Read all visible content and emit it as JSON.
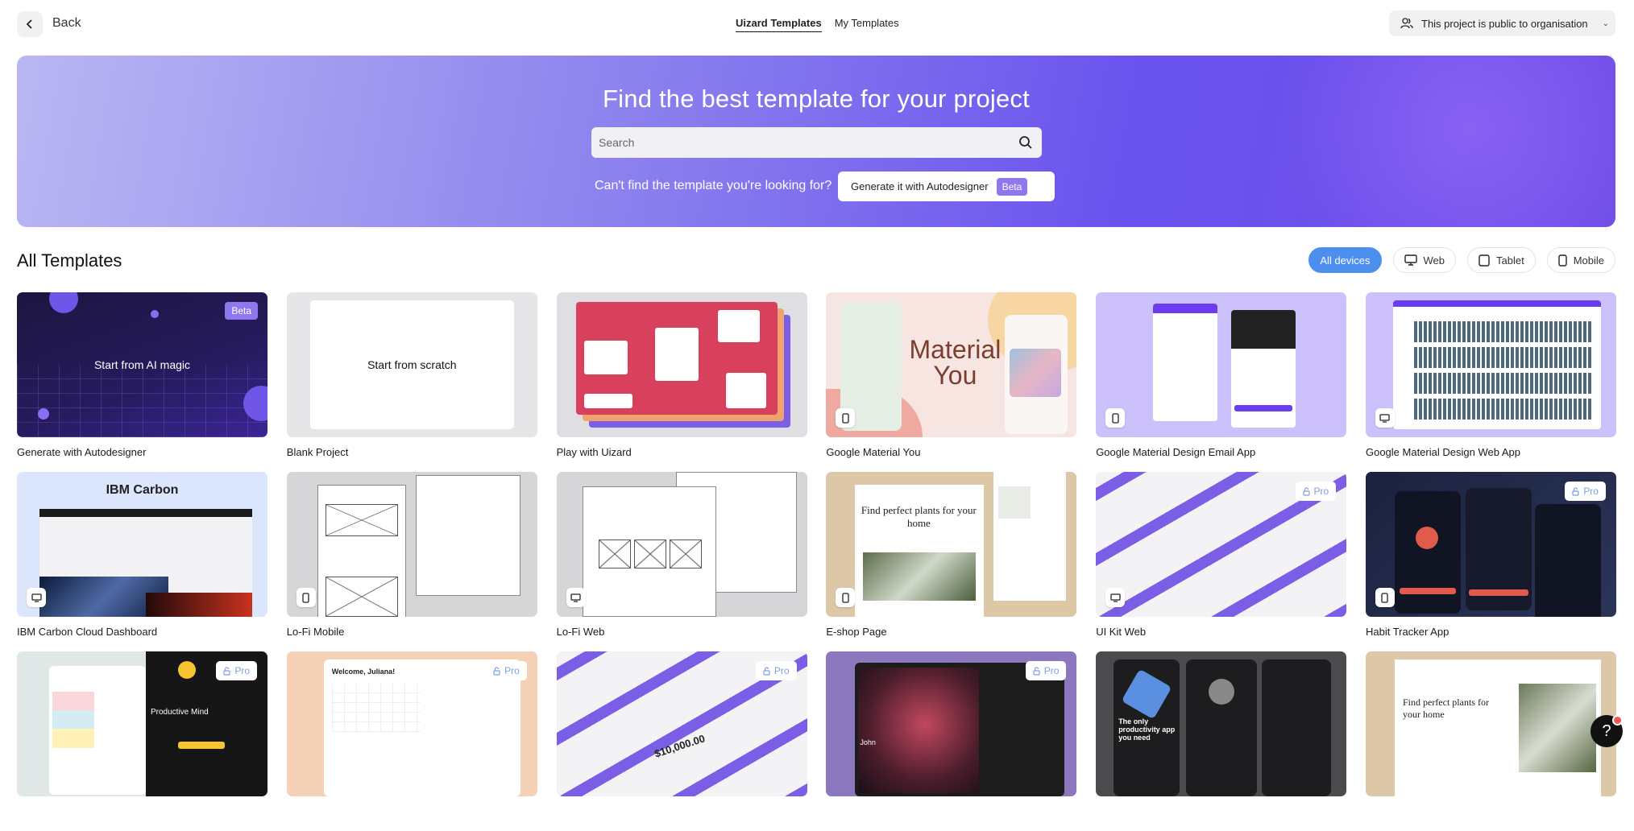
{
  "topbar": {
    "back_label": "Back",
    "tabs": [
      {
        "label": "Uizard Templates",
        "active": true
      },
      {
        "label": "My Templates",
        "active": false
      }
    ],
    "visibility_label": "This project is public to organisation"
  },
  "hero": {
    "title": "Find the best template for your project",
    "search_placeholder": "Search",
    "cant_find": "Can't find the template you're looking for?",
    "generate_label": "Generate it with Autodesigner",
    "generate_badge": "Beta"
  },
  "section": {
    "title": "All Templates",
    "filters": [
      {
        "label": "All devices",
        "active": true,
        "icon": ""
      },
      {
        "label": "Web",
        "active": false,
        "icon": "monitor-icon"
      },
      {
        "label": "Tablet",
        "active": false,
        "icon": "tablet-icon"
      },
      {
        "label": "Mobile",
        "active": false,
        "icon": "mobile-icon"
      }
    ]
  },
  "templates": [
    {
      "label": "Generate with Autodesigner",
      "thumb_text": "Start from AI magic",
      "badge": "Beta",
      "device": ""
    },
    {
      "label": "Blank Project",
      "thumb_text": "Start from scratch",
      "badge": "",
      "device": ""
    },
    {
      "label": "Play with Uizard",
      "thumb_text": "",
      "badge": "",
      "device": ""
    },
    {
      "label": "Google Material You",
      "thumb_text": "Material You",
      "badge": "",
      "device": "mobile-icon"
    },
    {
      "label": "Google Material Design Email App",
      "thumb_text": "",
      "badge": "",
      "device": "mobile-icon"
    },
    {
      "label": "Google Material Design Web App",
      "thumb_text": "",
      "badge": "",
      "device": "monitor-icon"
    },
    {
      "label": "IBM Carbon Cloud Dashboard",
      "thumb_text": "IBM Carbon",
      "badge": "",
      "device": "monitor-icon"
    },
    {
      "label": "Lo-Fi Mobile",
      "thumb_text": "",
      "badge": "",
      "device": "mobile-icon"
    },
    {
      "label": "Lo-Fi Web",
      "thumb_text": "",
      "badge": "",
      "device": "monitor-icon"
    },
    {
      "label": "E-shop Page",
      "thumb_text": "Find perfect plants for your home",
      "badge": "",
      "device": "mobile-icon"
    },
    {
      "label": "UI Kit Web",
      "thumb_text": "",
      "badge": "Pro",
      "device": "monitor-icon"
    },
    {
      "label": "Habit Tracker App",
      "thumb_text": "",
      "badge": "Pro",
      "device": "mobile-icon"
    },
    {
      "label": "",
      "thumb_text": "Productive Mind",
      "badge": "Pro",
      "device": ""
    },
    {
      "label": "",
      "thumb_text": "Welcome, Juliana!",
      "badge": "Pro",
      "device": ""
    },
    {
      "label": "",
      "thumb_text": "$10,000.00",
      "badge": "Pro",
      "device": ""
    },
    {
      "label": "",
      "thumb_text": "John",
      "badge": "Pro",
      "device": ""
    },
    {
      "label": "",
      "thumb_text": "The only productivity app you need",
      "badge": "",
      "device": ""
    },
    {
      "label": "",
      "thumb_text": "Find perfect plants for your home",
      "badge": "",
      "device": ""
    }
  ],
  "help_label": "?"
}
